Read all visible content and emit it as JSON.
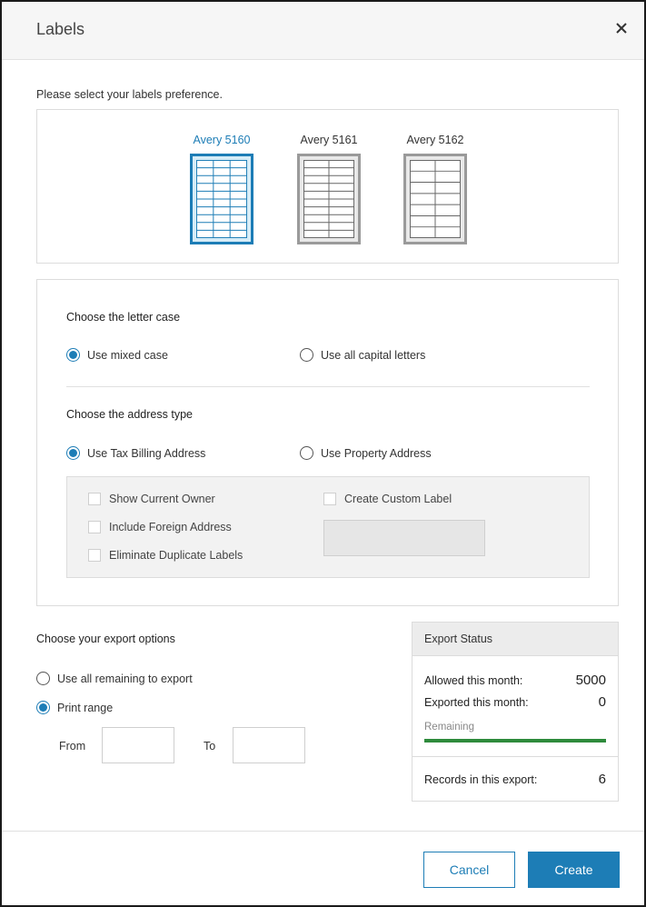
{
  "dialog": {
    "title": "Labels",
    "close_icon": "close-icon"
  },
  "labels_prompt": "Please select your labels preference.",
  "label_options": [
    {
      "name": "Avery 5160",
      "selected": true
    },
    {
      "name": "Avery 5161",
      "selected": false
    },
    {
      "name": "Avery 5162",
      "selected": false
    }
  ],
  "letter_case": {
    "title": "Choose the letter case",
    "options": [
      {
        "label": "Use mixed case",
        "selected": true
      },
      {
        "label": "Use all capital letters",
        "selected": false
      }
    ]
  },
  "address_type": {
    "title": "Choose the address type",
    "options": [
      {
        "label": "Use Tax Billing Address",
        "selected": true
      },
      {
        "label": "Use Property Address",
        "selected": false
      }
    ],
    "checkboxes": [
      {
        "label": "Show Current Owner",
        "checked": false
      },
      {
        "label": "Include Foreign Address",
        "checked": false
      },
      {
        "label": "Eliminate Duplicate Labels",
        "checked": false
      },
      {
        "label": "Create Custom Label",
        "checked": false
      }
    ],
    "custom_label_value": ""
  },
  "export": {
    "title": "Choose your export options",
    "options": [
      {
        "label": "Use all remaining to export",
        "selected": false
      },
      {
        "label": "Print range",
        "selected": true
      }
    ],
    "from_label": "From",
    "to_label": "To",
    "from_value": "",
    "to_value": ""
  },
  "export_status": {
    "title": "Export Status",
    "allowed_label": "Allowed this month:",
    "allowed_value": "5000",
    "exported_label": "Exported this month:",
    "exported_value": "0",
    "remaining_label": "Remaining",
    "remaining_fraction": 1.0,
    "records_label": "Records in this export:",
    "records_value": "6"
  },
  "buttons": {
    "cancel": "Cancel",
    "create": "Create"
  },
  "colors": {
    "accent": "#1d7db6",
    "progress": "#2e8b3c"
  }
}
